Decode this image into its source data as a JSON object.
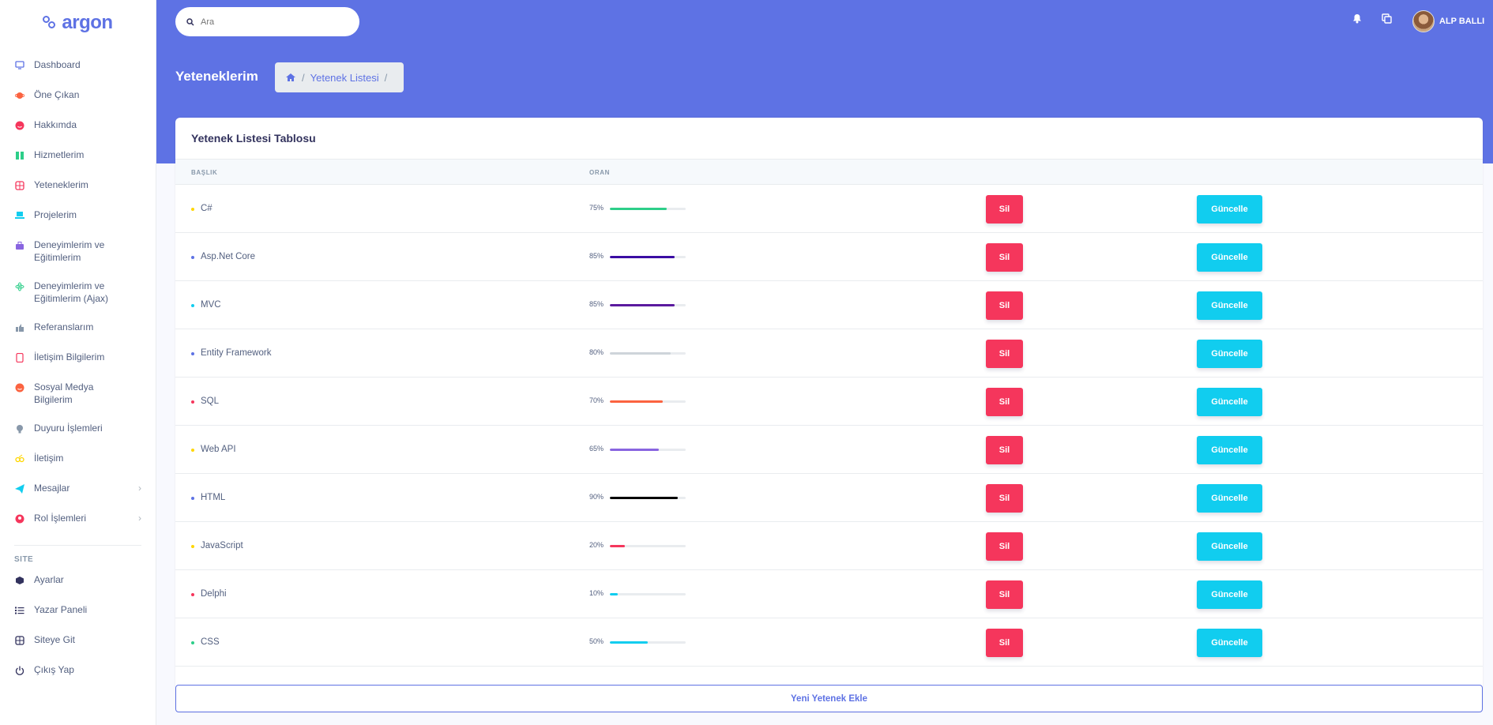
{
  "brand": {
    "name": "argon"
  },
  "sidebar": {
    "items": [
      {
        "label": "Dashboard",
        "icon": "tv-icon",
        "color": "#5e72e4"
      },
      {
        "label": "Öne Çıkan",
        "icon": "planet-icon",
        "color": "#fb6340"
      },
      {
        "label": "Hakkımda",
        "icon": "smile-icon",
        "color": "#f5365c"
      },
      {
        "label": "Hizmetlerim",
        "icon": "building-icon",
        "color": "#2dce89"
      },
      {
        "label": "Yeteneklerim",
        "icon": "support-icon",
        "color": "#f5365c"
      },
      {
        "label": "Projelerim",
        "icon": "laptop-icon",
        "color": "#11cdef"
      },
      {
        "label": "Deneyimlerim ve Eğitimlerim",
        "icon": "briefcase-icon",
        "color": "#8965e0"
      },
      {
        "label": "Deneyimlerim ve Eğitimlerim (Ajax)",
        "icon": "atom-icon",
        "color": "#2dce89"
      },
      {
        "label": "Referanslarım",
        "icon": "thumbs-up-icon",
        "color": "#8898aa"
      },
      {
        "label": "İletişim Bilgilerim",
        "icon": "tablet-icon",
        "color": "#f5365c"
      },
      {
        "label": "Sosyal Medya Bilgilerim",
        "icon": "satisfied-icon",
        "color": "#fb6340"
      },
      {
        "label": "Duyuru İşlemleri",
        "icon": "bulb-icon",
        "color": "#8898aa"
      },
      {
        "label": "İletişim",
        "icon": "glasses-icon",
        "color": "#ffd600"
      },
      {
        "label": "Mesajlar",
        "icon": "send-icon",
        "color": "#11cdef",
        "expandable": true
      },
      {
        "label": "Rol İşlemleri",
        "icon": "user-circle-icon",
        "color": "#f5365c",
        "expandable": true
      }
    ],
    "site_heading": "SITE",
    "site_items": [
      {
        "label": "Ayarlar",
        "icon": "box-icon"
      },
      {
        "label": "Yazar Paneli",
        "icon": "list-icon"
      },
      {
        "label": "Siteye Git",
        "icon": "support-icon"
      },
      {
        "label": "Çıkış Yap",
        "icon": "power-icon"
      }
    ]
  },
  "header": {
    "search_placeholder": "Ara",
    "user_name": "ALP BALLI",
    "page_title": "Yeteneklerim",
    "breadcrumb": {
      "home_icon": "home-icon",
      "current": "Yetenek Listesi"
    }
  },
  "card": {
    "title": "Yetenek Listesi Tablosu",
    "columns": [
      "BAŞLIK",
      "ORAN"
    ],
    "rows": [
      {
        "name": "C#",
        "value": 75,
        "dot_color": "#ffd600",
        "bar_color": "#2dce89"
      },
      {
        "name": "Asp.Net Core",
        "value": 85,
        "dot_color": "#5e72e4",
        "bar_color": "#3a0ca3"
      },
      {
        "name": "MVC",
        "value": 85,
        "dot_color": "#11cdef",
        "bar_color": "#5b1a9e"
      },
      {
        "name": "Entity Framework",
        "value": 80,
        "dot_color": "#5e72e4",
        "bar_color": "#ced4da"
      },
      {
        "name": "SQL",
        "value": 70,
        "dot_color": "#f5365c",
        "bar_color": "#fb6340"
      },
      {
        "name": "Web API",
        "value": 65,
        "dot_color": "#ffd600",
        "bar_color": "#8965e0"
      },
      {
        "name": "HTML",
        "value": 90,
        "dot_color": "#5e72e4",
        "bar_color": "#000000"
      },
      {
        "name": "JavaScript",
        "value": 20,
        "dot_color": "#ffd600",
        "bar_color": "#f5365c"
      },
      {
        "name": "Delphi",
        "value": 10,
        "dot_color": "#f5365c",
        "bar_color": "#11cdef"
      },
      {
        "name": "CSS",
        "value": 50,
        "dot_color": "#2dce89",
        "bar_color": "#11cdef"
      }
    ],
    "delete_label": "Sil",
    "update_label": "Güncelle",
    "add_label": "Yeni Yetenek Ekle"
  }
}
